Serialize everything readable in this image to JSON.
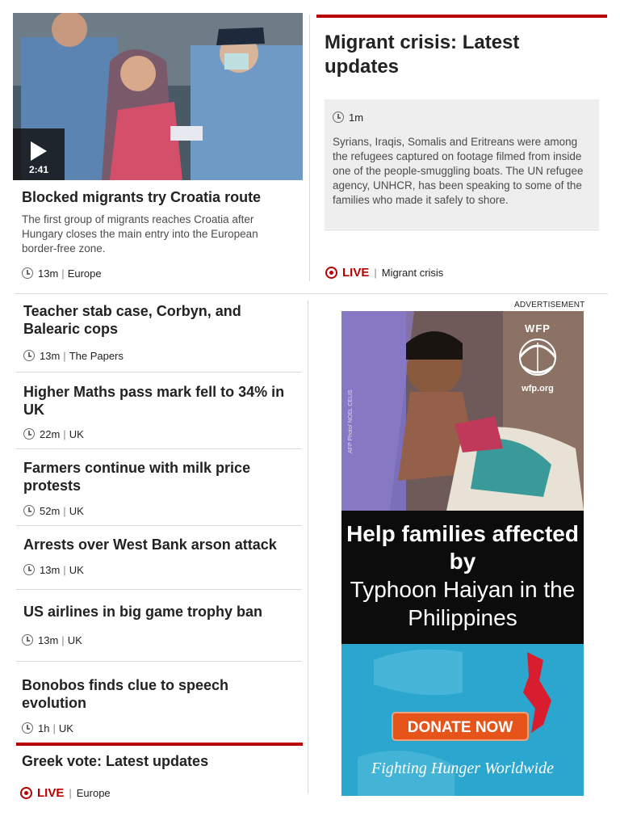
{
  "top_story": {
    "video_duration": "2:41",
    "headline": "Blocked migrants try Croatia route",
    "summary": "The first group of migrants reaches Croatia after Hungary closes the main entry into the European border-free zone.",
    "time": "13m",
    "section": "Europe"
  },
  "live_feature": {
    "title": "Migrant crisis: Latest updates",
    "update_time": "1m",
    "update_text": "Syrians, Iraqis, Somalis and Eritreans were among the refugees captured on footage filmed from inside one of the people-smuggling boats. The UN refugee agency, UNHCR, has been speaking to some of the families who made it safely to shore.",
    "live_label": "LIVE",
    "section": "Migrant crisis"
  },
  "stories": [
    {
      "headline": "Teacher stab case, Corbyn, and Balearic cops",
      "time": "13m",
      "section": "The Papers"
    },
    {
      "headline": "Higher Maths pass mark fell to 34% in UK",
      "time": "22m",
      "section": "UK"
    },
    {
      "headline": "Farmers continue with milk price protests",
      "time": "52m",
      "section": "UK"
    },
    {
      "headline": "Arrests over West Bank arson attack",
      "time": "13m",
      "section": "UK"
    },
    {
      "headline": "US airlines in big game trophy ban",
      "time": "13m",
      "section": "UK"
    },
    {
      "headline": "Bonobos finds clue to speech evolution",
      "time": "1h",
      "section": "UK"
    }
  ],
  "bottom_live": {
    "title": "Greek vote: Latest updates",
    "live_label": "LIVE",
    "section": "Europe"
  },
  "ad": {
    "label": "ADVERTISEMENT",
    "logo_text": "WFP",
    "logo_url": "wfp.org",
    "headline_bold": "Help families affected by",
    "headline_regular": "Typhoon Haiyan in the Philippines",
    "cta": "DONATE NOW",
    "tagline": "Fighting Hunger Worldwide",
    "photo_credit": "AFP Photo/ NOEL CELIS"
  },
  "colors": {
    "accent_red": "#b80000",
    "ad_blue": "#2aa6cf",
    "donate_orange": "#e65419"
  }
}
